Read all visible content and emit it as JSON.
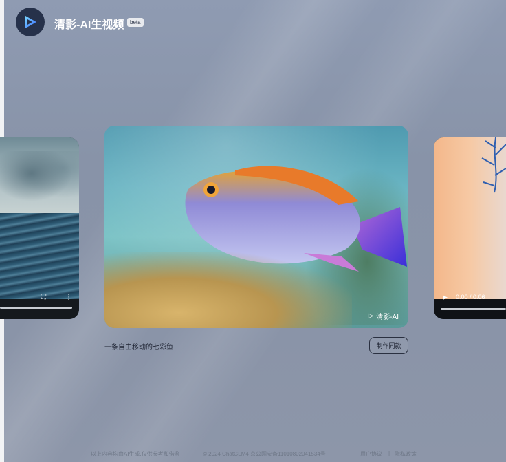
{
  "header": {
    "brand_title": "清影-AI生视频",
    "beta_label": "beta",
    "logo_icon": "play-logo-icon"
  },
  "carousel": {
    "center": {
      "description": "一条自由移动的七彩鱼",
      "make_same_label": "制作同款",
      "watermark": "清影-AI"
    },
    "right": {
      "time": "0:00 / 0:06"
    }
  },
  "footer": {
    "disclaimer": "以上内容均由AI生成,仅供参考和借鉴",
    "copyright": "© 2024 ChatGLM4 京公网安备11010802041534号",
    "user_agreement": "用户协议",
    "separator": "|",
    "privacy_policy": "隐私政策"
  },
  "colors": {
    "background": "#8a94a8",
    "logo_bg": "#26314a",
    "text_dark": "#1d2231"
  }
}
